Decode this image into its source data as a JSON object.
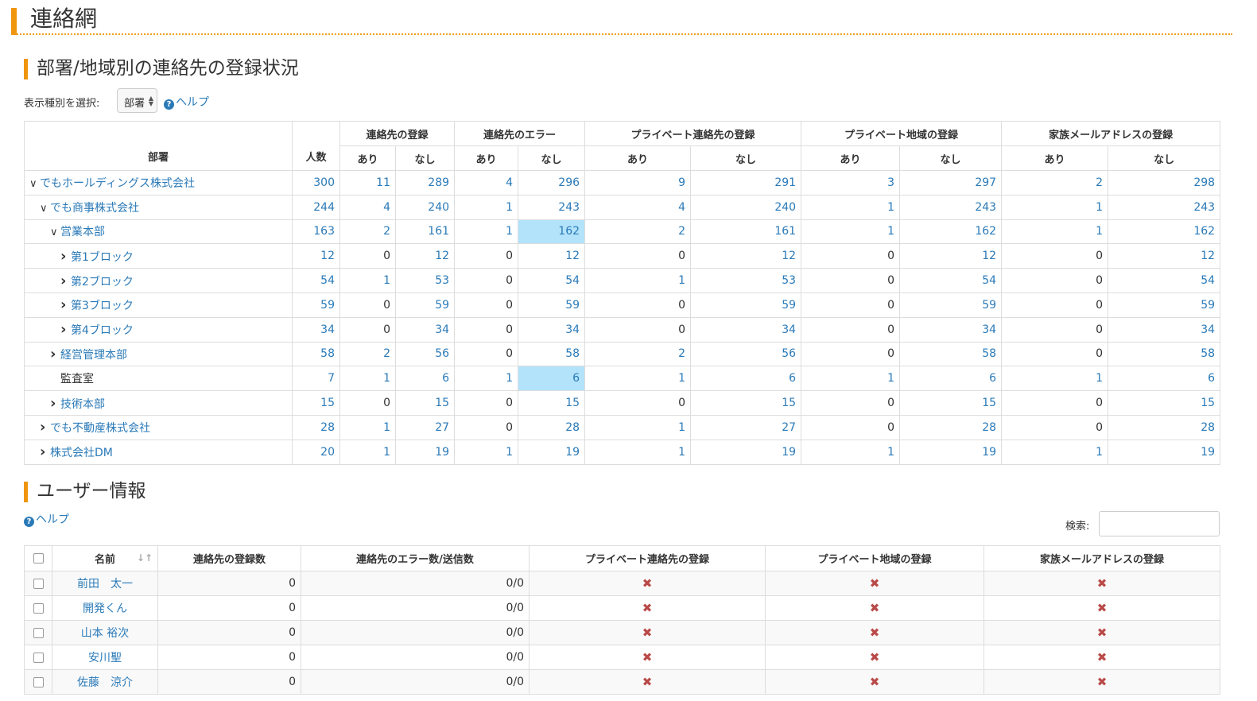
{
  "page_title": "連絡網",
  "section1": {
    "title": "部署/地域別の連絡先の登録状況",
    "select_label": "表示種別を選択:",
    "select_value": "部署",
    "help": "ヘルプ",
    "headers": {
      "dept": "部署",
      "count": "人数",
      "groups": [
        "連絡先の登録",
        "連絡先のエラー",
        "プライベート連絡先の登録",
        "プライベート地域の登録",
        "家族メールアドレスの登録"
      ],
      "yes": "あり",
      "no": "なし"
    },
    "rows": [
      {
        "name": "でもホールディングス株式会社",
        "chevron": "down",
        "indent": 0,
        "vals": [
          "300",
          "11",
          "289",
          "4",
          "296",
          "9",
          "291",
          "3",
          "297",
          "2",
          "298"
        ]
      },
      {
        "name": "でも商事株式会社",
        "chevron": "down",
        "indent": 1,
        "vals": [
          "244",
          "4",
          "240",
          "1",
          "243",
          "4",
          "240",
          "1",
          "243",
          "1",
          "243"
        ]
      },
      {
        "name": "営業本部",
        "chevron": "down",
        "indent": 2,
        "vals": [
          "163",
          "2",
          "161",
          "1",
          "162",
          "2",
          "161",
          "1",
          "162",
          "1",
          "162"
        ]
      },
      {
        "name": "第1ブロック",
        "chevron": "right",
        "indent": 3,
        "vals": [
          "12",
          "0",
          "12",
          "0",
          "12",
          "0",
          "12",
          "0",
          "12",
          "0",
          "12"
        ]
      },
      {
        "name": "第2ブロック",
        "chevron": "right",
        "indent": 3,
        "vals": [
          "54",
          "1",
          "53",
          "0",
          "54",
          "1",
          "53",
          "0",
          "54",
          "0",
          "54"
        ]
      },
      {
        "name": "第3ブロック",
        "chevron": "right",
        "indent": 3,
        "vals": [
          "59",
          "0",
          "59",
          "0",
          "59",
          "0",
          "59",
          "0",
          "59",
          "0",
          "59"
        ]
      },
      {
        "name": "第4ブロック",
        "chevron": "right",
        "indent": 3,
        "vals": [
          "34",
          "0",
          "34",
          "0",
          "34",
          "0",
          "34",
          "0",
          "34",
          "0",
          "34"
        ]
      },
      {
        "name": "経営管理本部",
        "chevron": "right",
        "indent": 2,
        "vals": [
          "58",
          "2",
          "56",
          "0",
          "58",
          "2",
          "56",
          "0",
          "58",
          "0",
          "58"
        ]
      },
      {
        "name": "監査室",
        "chevron": "none",
        "indent": 2,
        "vals": [
          "7",
          "1",
          "6",
          "1",
          "6",
          "1",
          "6",
          "1",
          "6",
          "1",
          "6"
        ]
      },
      {
        "name": "技術本部",
        "chevron": "right",
        "indent": 2,
        "vals": [
          "15",
          "0",
          "15",
          "0",
          "15",
          "0",
          "15",
          "0",
          "15",
          "0",
          "15"
        ]
      },
      {
        "name": "でも不動産株式会社",
        "chevron": "right",
        "indent": 1,
        "vals": [
          "28",
          "1",
          "27",
          "0",
          "28",
          "1",
          "27",
          "0",
          "28",
          "0",
          "28"
        ]
      },
      {
        "name": "株式会社DM",
        "chevron": "right",
        "indent": 1,
        "vals": [
          "20",
          "1",
          "19",
          "1",
          "19",
          "1",
          "19",
          "1",
          "19",
          "1",
          "19"
        ]
      }
    ]
  },
  "section2": {
    "title": "ユーザー情報",
    "help": "ヘルプ",
    "search_label": "検索:",
    "headers": [
      "名前",
      "連絡先の登録数",
      "連絡先のエラー数/送信数",
      "プライベート連絡先の登録",
      "プライベート地域の登録",
      "家族メールアドレスの登録"
    ],
    "users": [
      {
        "name": "前田　太一",
        "count": "0",
        "err": "0/0"
      },
      {
        "name": "開発くん",
        "count": "0",
        "err": "0/0"
      },
      {
        "name": "山本 裕次",
        "count": "0",
        "err": "0/0"
      },
      {
        "name": "安川聖",
        "count": "0",
        "err": "0/0"
      },
      {
        "name": "佐藤　涼介",
        "count": "0",
        "err": "0/0"
      }
    ]
  }
}
